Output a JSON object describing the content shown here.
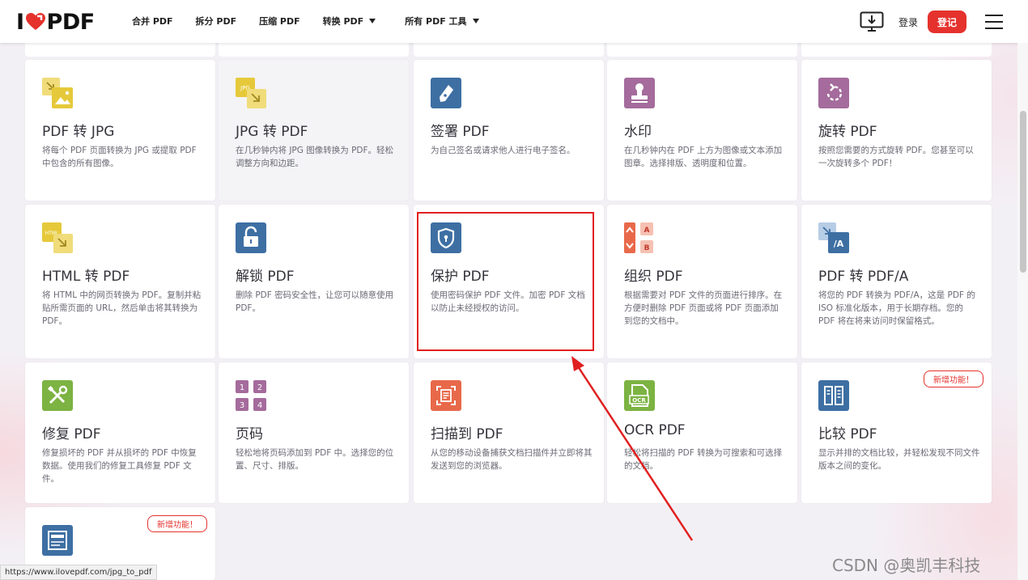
{
  "header": {
    "logo_left": "I",
    "logo_right": "PDF",
    "nav": [
      {
        "label": "合并 PDF",
        "has_caret": false
      },
      {
        "label": "拆分 PDF",
        "has_caret": false
      },
      {
        "label": "压缩 PDF",
        "has_caret": false
      },
      {
        "label": "转换 PDF",
        "has_caret": true
      },
      {
        "label": "所有 PDF 工具",
        "has_caret": true
      }
    ],
    "login_label": "登录",
    "signup_label": "登记"
  },
  "tools": [
    {
      "title": "PDF 转 JPG",
      "desc": "将每个 PDF 页面转换为 JPG 或提取 PDF 中包含的所有图像。",
      "icon": "pdf-to-jpg-icon"
    },
    {
      "title": "JPG 转 PDF",
      "desc": "在几秒钟内将 JPG 图像转换为 PDF。轻松调整方向和边距。",
      "icon": "jpg-to-pdf-icon"
    },
    {
      "title": "签署 PDF",
      "desc": "为自己签名或请求他人进行电子签名。",
      "icon": "sign-pdf-icon"
    },
    {
      "title": "水印",
      "desc": "在几秒钟内在 PDF 上方为图像或文本添加图章。选择排版、透明度和位置。",
      "icon": "watermark-icon"
    },
    {
      "title": "旋转 PDF",
      "desc": "按照您需要的方式旋转 PDF。您甚至可以一次旋转多个 PDF！",
      "icon": "rotate-pdf-icon"
    },
    {
      "title": "HTML 转 PDF",
      "desc": "将 HTML 中的网页转换为 PDF。复制并粘贴所需页面的 URL，然后单击将其转换为 PDF。",
      "icon": "html-to-pdf-icon",
      "icon_text": "HTML"
    },
    {
      "title": "解锁 PDF",
      "desc": "删除 PDF 密码安全性，让您可以随意使用 PDF。",
      "icon": "unlock-pdf-icon"
    },
    {
      "title": "保护 PDF",
      "desc": "使用密码保护 PDF 文件。加密 PDF 文档以防止未经授权的访问。",
      "icon": "protect-pdf-icon"
    },
    {
      "title": "组织 PDF",
      "desc": "根据需要对 PDF 文件的页面进行排序。在方便时删除 PDF 页面或将 PDF 页面添加到您的文档中。",
      "icon": "organize-pdf-icon",
      "icon_a": "A",
      "icon_b": "B"
    },
    {
      "title": "PDF 转 PDF/A",
      "desc": "将您的 PDF 转换为 PDF/A，这是 PDF 的 ISO 标准化版本，用于长期存档。您的 PDF 将在将来访问时保留格式。",
      "icon": "pdf-to-pdfa-icon",
      "icon_text": "/A"
    },
    {
      "title": "修复 PDF",
      "desc": "修复损坏的 PDF 并从损坏的 PDF 中恢复数据。使用我们的修复工具修复 PDF 文件。",
      "icon": "repair-pdf-icon"
    },
    {
      "title": "页码",
      "desc": "轻松地将页码添加到 PDF 中。选择您的位置、尺寸、排版。",
      "icon": "page-numbers-icon",
      "digits": [
        "1",
        "2",
        "3",
        "4"
      ]
    },
    {
      "title": "扫描到 PDF",
      "desc": "从您的移动设备捕获文档扫描件并立即将其发送到您的浏览器。",
      "icon": "scan-to-pdf-icon"
    },
    {
      "title": "OCR PDF",
      "desc": "轻松将扫描的 PDF 转换为可搜索和可选择的文档。",
      "icon": "ocr-pdf-icon",
      "icon_text": "OCR"
    },
    {
      "title": "比较 PDF",
      "desc": "显示并排的文档比较，并轻松发现不同文件版本之间的变化。",
      "icon": "compare-pdf-icon",
      "badge": "新增功能！"
    },
    {
      "title": "",
      "desc": "",
      "icon": "redact-pdf-icon",
      "badge": "新增功能！"
    }
  ],
  "icon_colors": {
    "yellow": "#e6c93a",
    "yellow_light": "#f0dc7a",
    "blue": "#3e6fa3",
    "purple": "#a46b9c",
    "orange": "#e8694a",
    "green": "#7cb342",
    "red": "#e5322d"
  },
  "status_url": "https://www.ilovepdf.com/jpg_to_pdf",
  "watermark": "CSDN @奥凯丰科技"
}
